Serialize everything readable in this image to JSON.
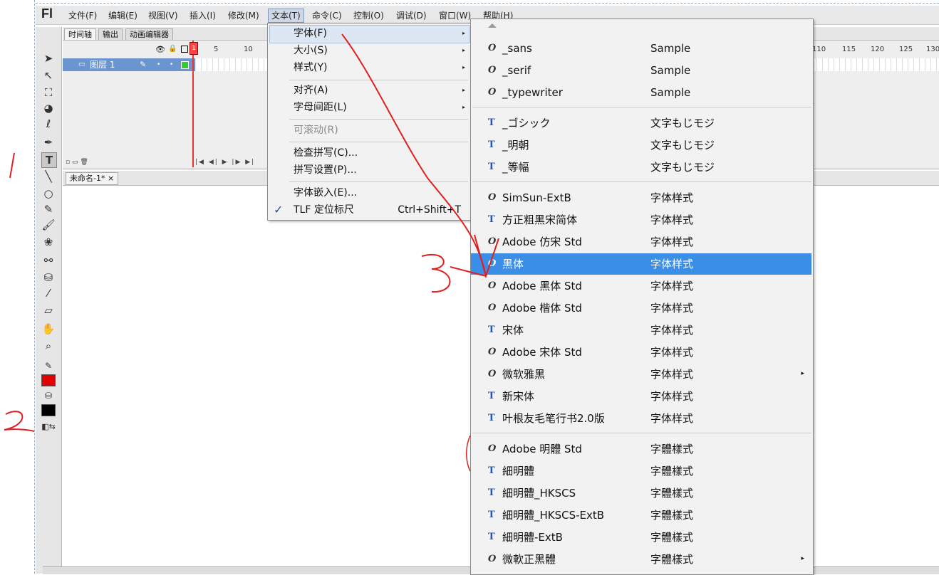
{
  "app": {
    "logo": "Fl"
  },
  "menubar": [
    {
      "label": "文件(F)"
    },
    {
      "label": "编辑(E)"
    },
    {
      "label": "视图(V)"
    },
    {
      "label": "插入(I)"
    },
    {
      "label": "修改(M)"
    },
    {
      "label": "文本(T)"
    },
    {
      "label": "命令(C)"
    },
    {
      "label": "控制(O)"
    },
    {
      "label": "调试(D)"
    },
    {
      "label": "窗口(W)"
    },
    {
      "label": "帮助(H)"
    }
  ],
  "timeline": {
    "tabs": [
      "时间轴",
      "输出",
      "动画编辑器"
    ],
    "layer_name": "图层 1",
    "playhead_frame": "1",
    "ruler_left": [
      "5",
      "10"
    ],
    "ruler_right": [
      "110",
      "115",
      "120",
      "125",
      "130"
    ]
  },
  "document": {
    "tab": "未命名-1*",
    "close": "×"
  },
  "text_menu": {
    "items": [
      {
        "label": "字体(F)",
        "arrow": "▸"
      },
      {
        "label": "大小(S)",
        "arrow": "▸"
      },
      {
        "label": "样式(Y)",
        "arrow": "▸"
      },
      {
        "label": "对齐(A)",
        "arrow": "▸"
      },
      {
        "label": "字母间距(L)",
        "arrow": "▸"
      },
      {
        "label": "可滚动(R)"
      },
      {
        "label": "检查拼写(C)..."
      },
      {
        "label": "拼写设置(P)..."
      },
      {
        "label": "字体嵌入(E)..."
      },
      {
        "label": "TLF 定位标尺",
        "shortcut": "Ctrl+Shift+T",
        "check": "✓"
      }
    ]
  },
  "font_menu": {
    "fonts": [
      {
        "icon": "O",
        "name": "_sans",
        "sample": "Sample"
      },
      {
        "icon": "O",
        "name": "_serif",
        "sample": "Sample"
      },
      {
        "icon": "O",
        "name": "_typewriter",
        "sample": "Sample"
      },
      {
        "icon": "T",
        "name": "_ゴシック",
        "sample": "文字もじモジ"
      },
      {
        "icon": "T",
        "name": "_明朝",
        "sample": "文字もじモジ"
      },
      {
        "icon": "T",
        "name": "_等幅",
        "sample": "文字もじモジ"
      },
      {
        "icon": "O",
        "name": "SimSun-ExtB",
        "sample": "字体样式"
      },
      {
        "icon": "T",
        "name": "方正粗黑宋简体",
        "sample": "字体样式"
      },
      {
        "icon": "O",
        "name": "Adobe 仿宋 Std",
        "sample": "字体样式"
      },
      {
        "icon": "O",
        "name": "黑体",
        "sample": "字体样式",
        "selected": true
      },
      {
        "icon": "O",
        "name": "Adobe 黑体 Std",
        "sample": "字体样式"
      },
      {
        "icon": "O",
        "name": "Adobe 楷体 Std",
        "sample": "字体样式"
      },
      {
        "icon": "T",
        "name": "宋体",
        "sample": "字体样式"
      },
      {
        "icon": "O",
        "name": "Adobe 宋体 Std",
        "sample": "字体样式"
      },
      {
        "icon": "O",
        "name": "微软雅黑",
        "sample": "字体样式",
        "submenu": "▸"
      },
      {
        "icon": "T",
        "name": "新宋体",
        "sample": "字体样式"
      },
      {
        "icon": "T",
        "name": "叶根友毛笔行书2.0版",
        "sample": "字体样式"
      },
      {
        "icon": "O",
        "name": "Adobe 明體 Std",
        "sample": "字體樣式"
      },
      {
        "icon": "T",
        "name": "細明體",
        "sample": "字體樣式"
      },
      {
        "icon": "T",
        "name": "細明體_HKSCS",
        "sample": "字體樣式"
      },
      {
        "icon": "T",
        "name": "細明體_HKSCS-ExtB",
        "sample": "字體樣式"
      },
      {
        "icon": "T",
        "name": "細明體-ExtB",
        "sample": "字體樣式"
      },
      {
        "icon": "O",
        "name": "微軟正黑體",
        "sample": "字體樣式",
        "submenu": "▸"
      }
    ]
  },
  "annotations": [
    "1",
    "2",
    "3"
  ],
  "colors": {
    "stroke": "#e00000",
    "fill": "#000000",
    "highlight": "#3b8ee6",
    "layer": "#6b95cf"
  }
}
